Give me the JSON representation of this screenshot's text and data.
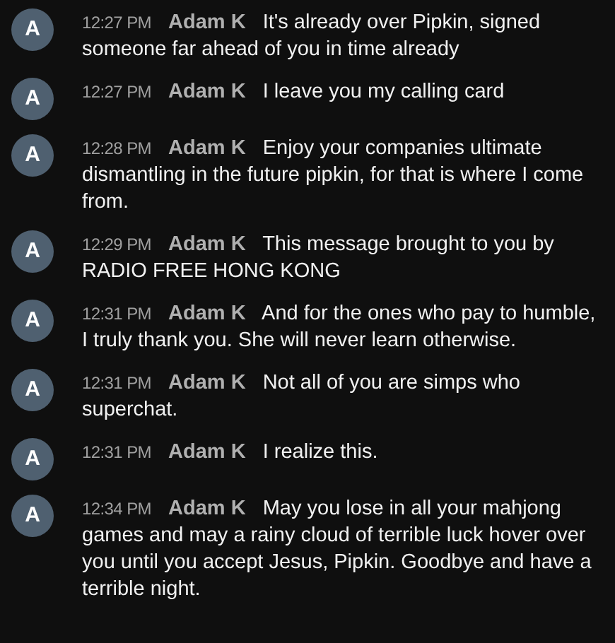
{
  "messages": [
    {
      "avatar": "A",
      "time": "12:27 PM",
      "author": "Adam K",
      "text": "It's already over Pipkin, signed someone far ahead of you in time already"
    },
    {
      "avatar": "A",
      "time": "12:27 PM",
      "author": "Adam K",
      "text": "I leave you my calling card"
    },
    {
      "avatar": "A",
      "time": "12:28 PM",
      "author": "Adam K",
      "text": "Enjoy your companies ultimate dismantling in the future pipkin, for that is where I come from."
    },
    {
      "avatar": "A",
      "time": "12:29 PM",
      "author": "Adam K",
      "text": "This message brought to you by RADIO FREE HONG KONG"
    },
    {
      "avatar": "A",
      "time": "12:31 PM",
      "author": "Adam K",
      "text": "And for the ones who pay to humble, I truly thank you. She will never learn otherwise."
    },
    {
      "avatar": "A",
      "time": "12:31 PM",
      "author": "Adam K",
      "text": "Not all of you are simps who superchat."
    },
    {
      "avatar": "A",
      "time": "12:31 PM",
      "author": "Adam K",
      "text": "I realize this."
    },
    {
      "avatar": "A",
      "time": "12:34 PM",
      "author": "Adam K",
      "text": "May you lose in all your mahjong games and may a rainy cloud of terrible luck hover over you until you accept Jesus, Pipkin. Goodbye and have a terrible night."
    }
  ]
}
